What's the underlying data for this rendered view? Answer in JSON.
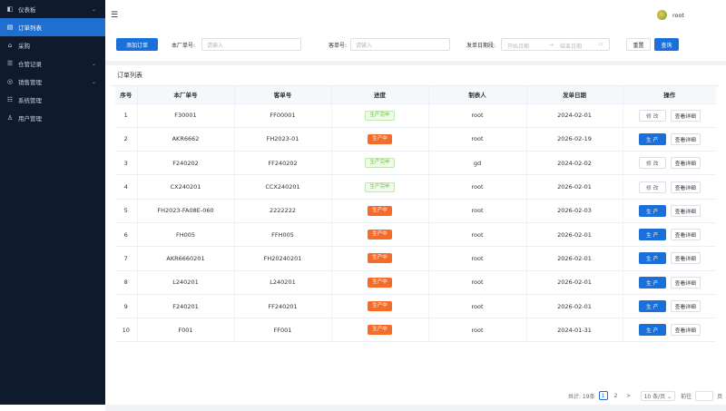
{
  "sidebar": {
    "items": [
      {
        "label": "仪表板",
        "icon": "dashboard-icon",
        "glyph": "◧",
        "chev": "⌄",
        "active": false
      },
      {
        "label": "订单列表",
        "icon": "order-list-icon",
        "glyph": "▤",
        "chev": "",
        "active": true
      },
      {
        "label": "采购",
        "icon": "purchase-icon",
        "glyph": "⌂",
        "chev": "",
        "active": false
      },
      {
        "label": "仓管记录",
        "icon": "warehouse-record-icon",
        "glyph": "☰",
        "chev": "⌄",
        "active": false
      },
      {
        "label": "销售管理",
        "icon": "sales-icon",
        "glyph": "◎",
        "chev": "⌄",
        "active": false
      },
      {
        "label": "系统管理",
        "icon": "system-icon",
        "glyph": "☷",
        "chev": "",
        "active": false
      },
      {
        "label": "用户管理",
        "icon": "user-manage-icon",
        "glyph": "♙",
        "chev": "",
        "active": false
      }
    ]
  },
  "topbar": {
    "menu_glyph": "☰",
    "username": "root"
  },
  "filters": {
    "add_order": "添加订单",
    "factory_label": "本厂单号:",
    "factory_placeholder": "请输入",
    "customer_label": "客单号:",
    "customer_placeholder": "请输入",
    "date_label": "发单日期段:",
    "date_start_placeholder": "开始日期",
    "date_sep": "→",
    "date_end_placeholder": "结束日期",
    "calendar_glyph": "▭",
    "reset": "重置",
    "search": "查询"
  },
  "panel": {
    "title": "订单列表"
  },
  "table": {
    "headers": [
      "序号",
      "本厂单号",
      "客单号",
      "进度",
      "制表人",
      "发单日期",
      "操作"
    ],
    "rows": [
      {
        "no": "1",
        "factory_no": "F30001",
        "customer_no": "FF00001",
        "status": "生产完毕",
        "status_type": "done",
        "creator": "root",
        "date": "2024-02-01",
        "action1": "修 改",
        "action1_type": "edit",
        "action2": "查看详细"
      },
      {
        "no": "2",
        "factory_no": "AKR6662",
        "customer_no": "FH2023-01",
        "status": "生产中",
        "status_type": "prod",
        "creator": "root",
        "date": "2026-02-19",
        "action1": "生 产",
        "action1_type": "prod",
        "action2": "查看详细"
      },
      {
        "no": "3",
        "factory_no": "F240202",
        "customer_no": "FF240202",
        "status": "生产完毕",
        "status_type": "done",
        "creator": "gd",
        "date": "2024-02-02",
        "action1": "修 改",
        "action1_type": "edit",
        "action2": "查看详细"
      },
      {
        "no": "4",
        "factory_no": "CX240201",
        "customer_no": "CCX240201",
        "status": "生产完毕",
        "status_type": "done",
        "creator": "root",
        "date": "2026-02-01",
        "action1": "修 改",
        "action1_type": "edit",
        "action2": "查看详细"
      },
      {
        "no": "5",
        "factory_no": "FH2023-FA08E-060",
        "customer_no": "2222222",
        "status": "生产中",
        "status_type": "prod",
        "creator": "root",
        "date": "2026-02-03",
        "action1": "生 产",
        "action1_type": "prod",
        "action2": "查看详细"
      },
      {
        "no": "6",
        "factory_no": "FH005",
        "customer_no": "FFH005",
        "status": "生产中",
        "status_type": "prod",
        "creator": "root",
        "date": "2026-02-01",
        "action1": "生 产",
        "action1_type": "prod",
        "action2": "查看详细"
      },
      {
        "no": "7",
        "factory_no": "AKR6660201",
        "customer_no": "FH20240201",
        "status": "生产中",
        "status_type": "prod",
        "creator": "root",
        "date": "2026-02-01",
        "action1": "生 产",
        "action1_type": "prod",
        "action2": "查看详细"
      },
      {
        "no": "8",
        "factory_no": "L240201",
        "customer_no": "L240201",
        "status": "生产中",
        "status_type": "prod",
        "creator": "root",
        "date": "2026-02-01",
        "action1": "生 产",
        "action1_type": "prod",
        "action2": "查看详细"
      },
      {
        "no": "9",
        "factory_no": "F240201",
        "customer_no": "FF240201",
        "status": "生产中",
        "status_type": "prod",
        "creator": "root",
        "date": "2026-02-01",
        "action1": "生 产",
        "action1_type": "prod",
        "action2": "查看详细"
      },
      {
        "no": "10",
        "factory_no": "F001",
        "customer_no": "FF001",
        "status": "生产中",
        "status_type": "prod",
        "creator": "root",
        "date": "2024-01-31",
        "action1": "生 产",
        "action1_type": "prod",
        "action2": "查看详细"
      }
    ]
  },
  "pagination": {
    "total": "共计: 19条",
    "page1": "1",
    "page2": "2",
    "next": ">",
    "page_size": "10 条/页 ⌄",
    "goto_label": "前往",
    "goto_suffix": "页"
  },
  "colors": {
    "sidebar_bg": "#0f1b2d",
    "accent": "#1a6fd8",
    "status_done": "#67c23a",
    "status_prod": "#f56c2a"
  }
}
